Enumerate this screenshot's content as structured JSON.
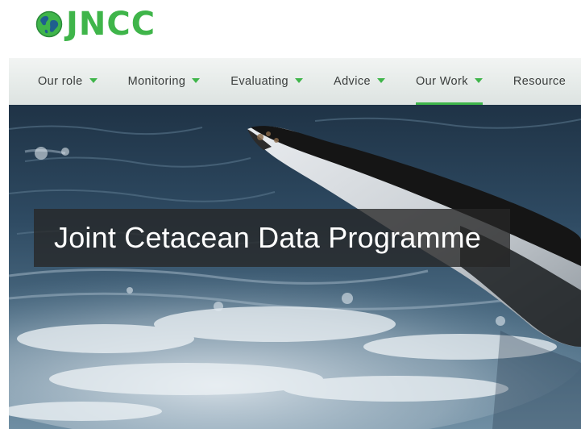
{
  "brand": {
    "name": "JNCC",
    "logo_icon": "globe-icon",
    "color": "#3fb54a"
  },
  "nav": {
    "items": [
      {
        "label": "Our role"
      },
      {
        "label": "Monitoring"
      },
      {
        "label": "Evaluating"
      },
      {
        "label": "Advice"
      },
      {
        "label": "Our Work",
        "active": true
      },
      {
        "label": "Resource"
      }
    ],
    "caret_icon": "caret-down-icon",
    "accent": "#3fb54a"
  },
  "hero": {
    "title": "Joint Cetacean Data Programme",
    "image": "whale-tail-photo"
  }
}
